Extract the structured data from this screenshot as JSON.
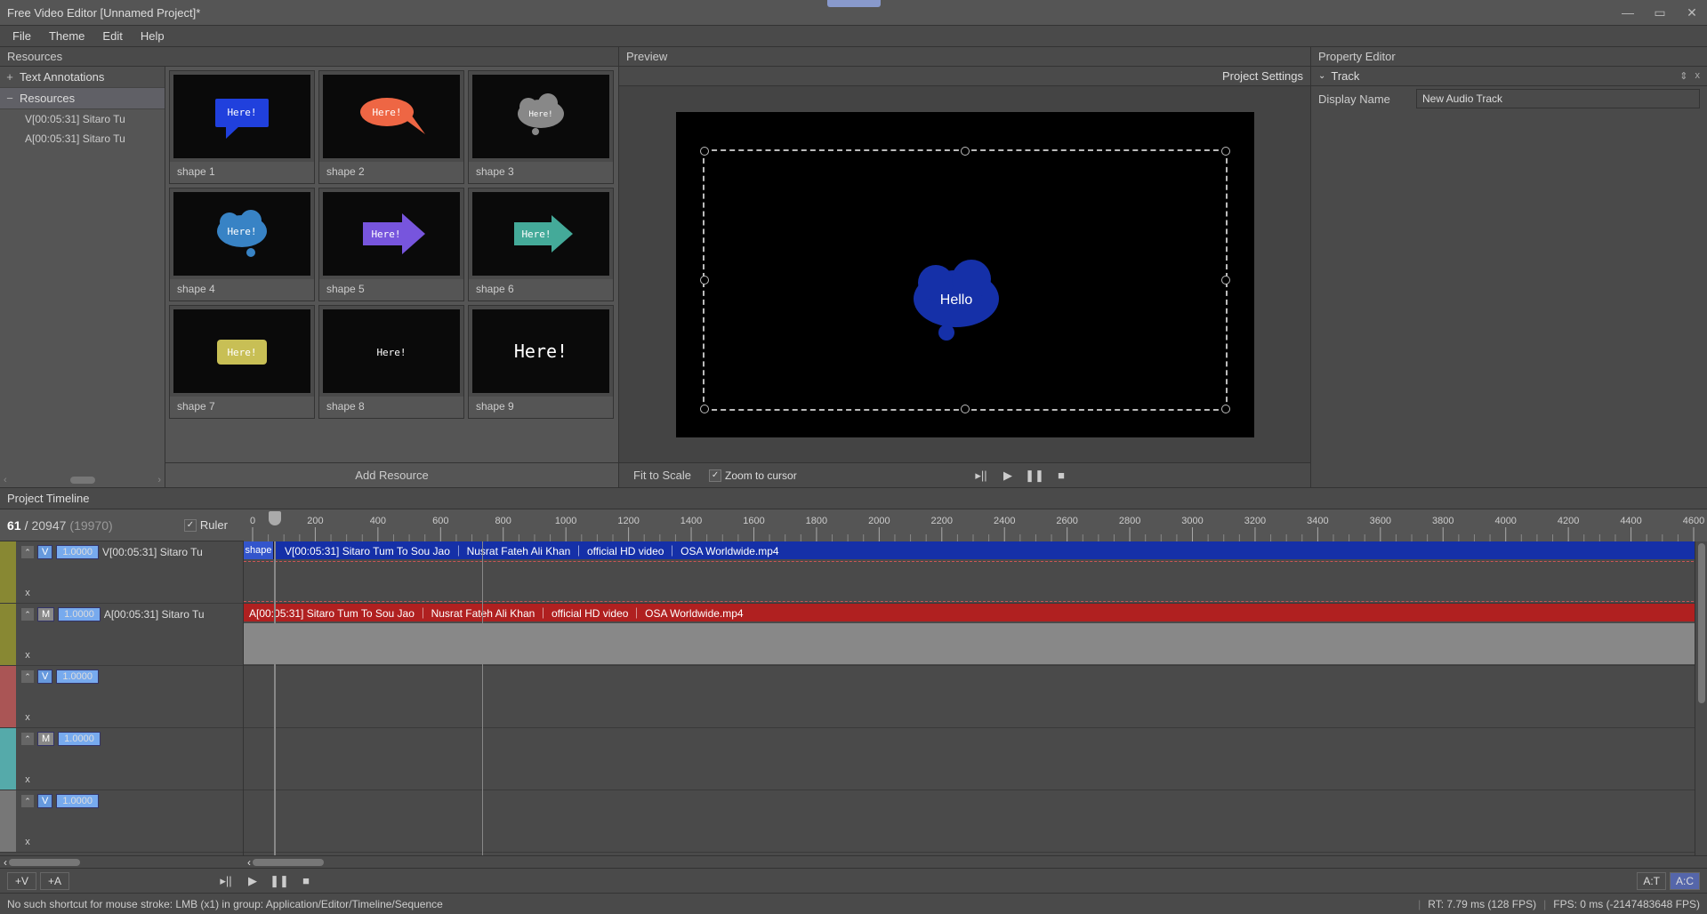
{
  "titlebar": {
    "title": "Free Video Editor [Unnamed Project]*"
  },
  "menu": [
    "File",
    "Theme",
    "Edit",
    "Help"
  ],
  "resources": {
    "panel_title": "Resources",
    "tree": {
      "text_annotations": "Text Annotations",
      "resources": "Resources",
      "children": [
        "V[00:05:31] Sitaro Tu",
        "A[00:05:31] Sitaro Tu"
      ]
    },
    "shapes": [
      {
        "label": "shape 1",
        "text": "Here!"
      },
      {
        "label": "shape 2",
        "text": "Here!"
      },
      {
        "label": "shape 3",
        "text": "Here!"
      },
      {
        "label": "shape 4",
        "text": "Here!"
      },
      {
        "label": "shape 5",
        "text": "Here!"
      },
      {
        "label": "shape 6",
        "text": "Here!"
      },
      {
        "label": "shape 7",
        "text": "Here!"
      },
      {
        "label": "shape 8",
        "text": "Here!"
      },
      {
        "label": "shape 9",
        "text": "Here!"
      }
    ],
    "add_resource": "Add Resource"
  },
  "preview": {
    "panel_title": "Preview",
    "project_settings": "Project Settings",
    "stage_text": "Hello",
    "fit_to_scale": "Fit to Scale",
    "zoom_to_cursor": "Zoom to cursor"
  },
  "property_editor": {
    "panel_title": "Property Editor",
    "section": "Track",
    "display_name_label": "Display Name",
    "display_name_value": "New Audio Track"
  },
  "timeline": {
    "panel_title": "Project Timeline",
    "frame_current": "61",
    "frame_total": "20947",
    "frame_paren": "(19970)",
    "ruler_label": "Ruler",
    "ruler_marks": [
      0,
      200,
      400,
      600,
      800,
      1000,
      1200,
      1400,
      1600,
      1800,
      2000,
      2200,
      2400,
      2600,
      2800,
      3000,
      3200,
      3400,
      3600,
      3800,
      4000,
      4200,
      4400,
      4600
    ],
    "tracks": [
      {
        "color": "yellow",
        "badge": "V",
        "num": "1.0000",
        "name": "V[00:05:31] Sitaro Tu"
      },
      {
        "color": "yellow",
        "badge": "M",
        "num": "1.0000",
        "name": "A[00:05:31] Sitaro Tu"
      },
      {
        "color": "red",
        "badge": "V",
        "num": "1.0000",
        "name": ""
      },
      {
        "color": "cyan",
        "badge": "M",
        "num": "1.0000",
        "name": ""
      },
      {
        "color": "gray",
        "badge": "V",
        "num": "1.0000",
        "name": ""
      }
    ],
    "clips": {
      "shape_label": "shape",
      "video": "V[00:05:31] Sitaro Tum To Sou Jao ｜ Nusrat Fateh Ali Khan ｜ official HD video ｜ OSA Worldwide.mp4",
      "audio": "A[00:05:31] Sitaro Tum To Sou Jao ｜ Nusrat Fateh Ali Khan ｜ official HD video ｜ OSA Worldwide.mp4"
    },
    "add_v": "+V",
    "add_a": "+A",
    "mode_at": "A:T",
    "mode_ac": "A:C"
  },
  "status": {
    "msg": "No such shortcut for mouse stroke: LMB (x1) in group: Application/Editor/Timeline/Sequence",
    "rt": "RT:  7.79 ms (128 FPS)",
    "fps": "FPS:    0 ms (-2147483648 FPS)"
  }
}
